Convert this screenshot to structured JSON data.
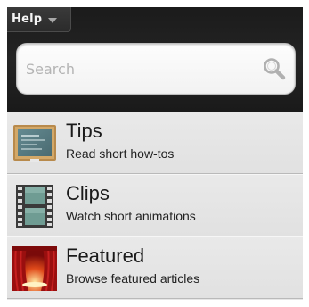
{
  "header": {
    "menu_label": "Help"
  },
  "search": {
    "placeholder": "Search",
    "value": ""
  },
  "items": [
    {
      "title": "Tips",
      "subtitle": "Read short how-tos",
      "icon": "chalkboard-icon"
    },
    {
      "title": "Clips",
      "subtitle": "Watch short animations",
      "icon": "film-strip-icon"
    },
    {
      "title": "Featured",
      "subtitle": "Browse featured articles",
      "icon": "stage-curtain-icon"
    }
  ],
  "colors": {
    "header_bg": "#1f1f1f",
    "list_bg": "#e6e6e6",
    "divider": "#b9b9b9"
  }
}
